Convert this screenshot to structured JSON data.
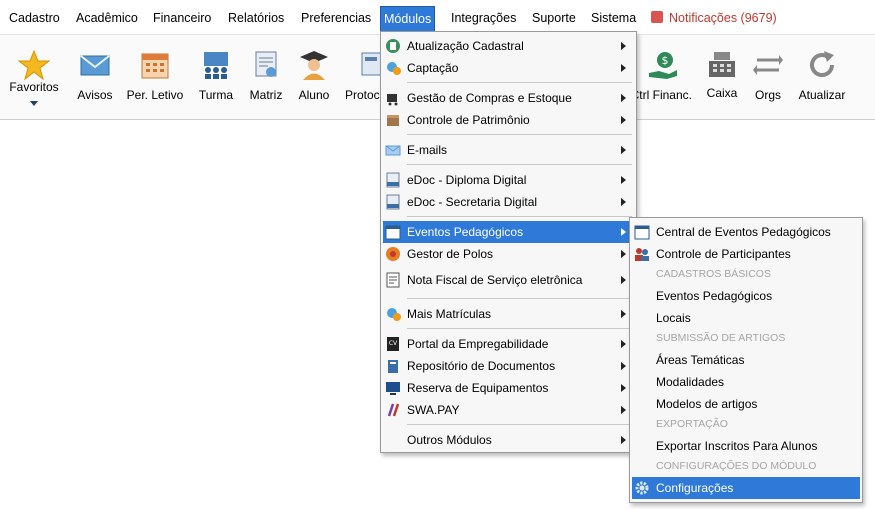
{
  "menubar": {
    "items": [
      {
        "label": "Cadastro"
      },
      {
        "label": "Acadêmico"
      },
      {
        "label": "Financeiro"
      },
      {
        "label": "Relatórios"
      },
      {
        "label": "Preferencias"
      },
      {
        "label": "Módulos"
      },
      {
        "label": "Integrações"
      },
      {
        "label": "Suporte"
      },
      {
        "label": "Sistema"
      }
    ],
    "notifications": "Notificações (9679)"
  },
  "toolbar": {
    "items": [
      {
        "label": "Favoritos",
        "icon": "star-icon"
      },
      {
        "label": "Avisos",
        "icon": "envelope-icon"
      },
      {
        "label": "Per. Letivo",
        "icon": "calendar-icon"
      },
      {
        "label": "Turma",
        "icon": "class-icon"
      },
      {
        "label": "Matriz",
        "icon": "certificate-icon"
      },
      {
        "label": "Aluno",
        "icon": "graduate-icon"
      },
      {
        "label": "Protoc",
        "icon": "protocol-icon"
      },
      {
        "label": "Ctrl Financ.",
        "icon": "money-hand-icon"
      },
      {
        "label": "Caixa",
        "icon": "cash-register-icon"
      },
      {
        "label": "Orgs",
        "icon": "swap-icon"
      },
      {
        "label": "Atualizar",
        "icon": "refresh-icon"
      }
    ]
  },
  "modules_menu": {
    "items": [
      {
        "label": "Atualização Cadastral"
      },
      {
        "label": "Captação"
      },
      {
        "label": "Gestão de Compras e Estoque"
      },
      {
        "label": "Controle de Patrimônio"
      },
      {
        "label": "E-mails"
      },
      {
        "label": "eDoc - Diploma Digital"
      },
      {
        "label": "eDoc - Secretaria Digital"
      },
      {
        "label": "Eventos Pedagógicos"
      },
      {
        "label": "Gestor de Polos"
      },
      {
        "label": "Nota Fiscal de Serviço eletrônica"
      },
      {
        "label": "Mais Matrículas"
      },
      {
        "label": "Portal da Empregabilidade"
      },
      {
        "label": "Repositório de Documentos"
      },
      {
        "label": "Reserva de Equipamentos"
      },
      {
        "label": "SWA.PAY"
      },
      {
        "label": "Outros Módulos"
      }
    ]
  },
  "events_submenu": {
    "items": [
      {
        "label": "Central de Eventos Pedagógicos"
      },
      {
        "label": "Controle de Participantes"
      },
      {
        "label": "Eventos Pedagógicos"
      },
      {
        "label": "Locais"
      },
      {
        "label": "Áreas Temáticas"
      },
      {
        "label": "Modalidades"
      },
      {
        "label": "Modelos de artigos"
      },
      {
        "label": "Exportar Inscritos Para Alunos"
      },
      {
        "label": "Configurações"
      }
    ],
    "headers": [
      "CADASTROS BÁSICOS",
      "SUBMISSÃO DE ARTIGOS",
      "EXPORTAÇÃO",
      "CONFIGURAÇÕES DO MÓDULO"
    ]
  },
  "colors": {
    "highlight": "#2f7ad9",
    "notification": "#c0392b"
  }
}
